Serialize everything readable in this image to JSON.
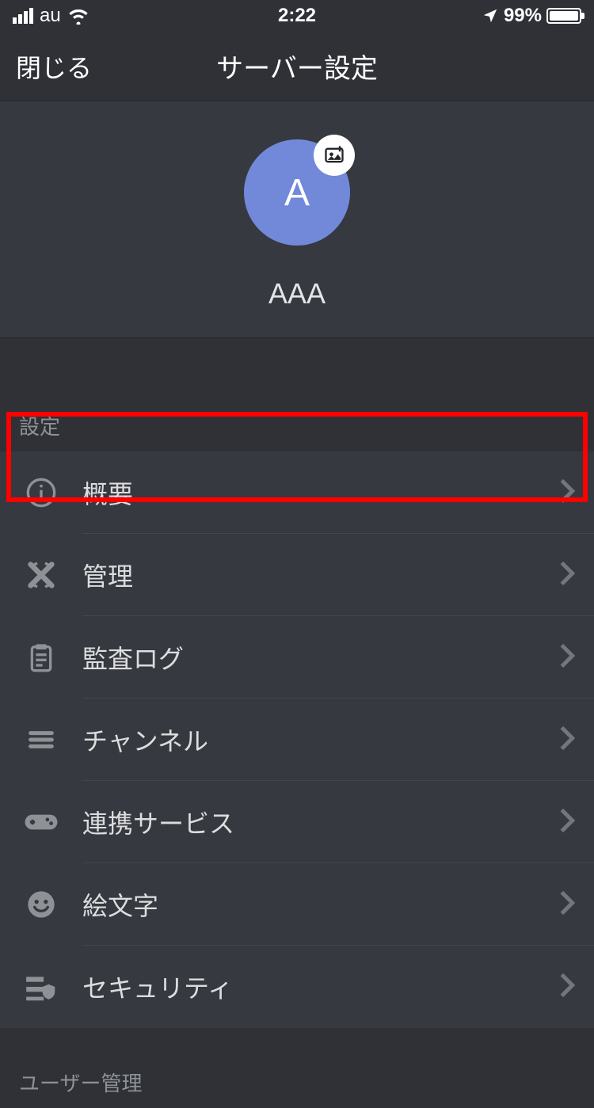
{
  "status": {
    "carrier": "au",
    "time": "2:22",
    "battery_pct": "99%"
  },
  "nav": {
    "close_label": "閉じる",
    "title": "サーバー設定"
  },
  "server": {
    "avatar_initial": "A",
    "name": "AAA"
  },
  "sections": {
    "settings_header": "設定",
    "user_mgmt_header": "ユーザー管理"
  },
  "settings_items": [
    {
      "label": "概要",
      "icon": "info"
    },
    {
      "label": "管理",
      "icon": "moderation"
    },
    {
      "label": "監査ログ",
      "icon": "audit"
    },
    {
      "label": "チャンネル",
      "icon": "channels"
    },
    {
      "label": "連携サービス",
      "icon": "integrations"
    },
    {
      "label": "絵文字",
      "icon": "emoji"
    },
    {
      "label": "セキュリティ",
      "icon": "security"
    }
  ]
}
